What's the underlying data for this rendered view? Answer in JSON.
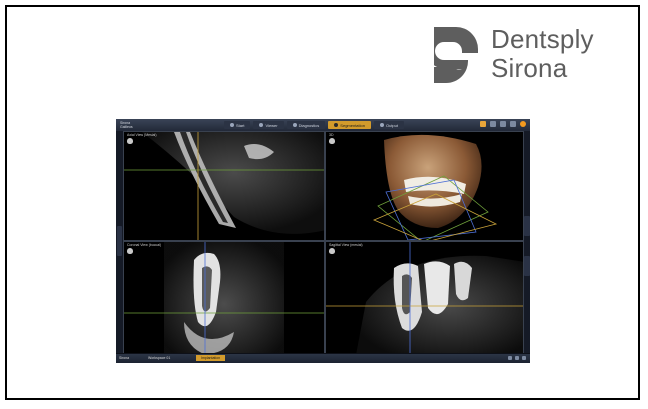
{
  "logo": {
    "line1": "Dentsply",
    "line2": "Sirona",
    "color": "#5e5e5e"
  },
  "app": {
    "brand_line1": "Sirona",
    "brand_line2": "Galileos",
    "tabs": [
      {
        "label": "Start",
        "icon": "start-icon"
      },
      {
        "label": "Viewer",
        "icon": "viewer-icon"
      },
      {
        "label": "Diagnostics",
        "icon": "diagnostics-icon"
      },
      {
        "label": "Segmentation",
        "icon": "segmentation-icon"
      },
      {
        "label": "Output",
        "icon": "output-icon"
      }
    ],
    "active_tab_index": 3,
    "accent_color": "#d29b2c",
    "viewports": {
      "panoramic": {
        "title": "Axial View (Mesial)"
      },
      "volume": {
        "title": "3D"
      },
      "coronal": {
        "title": "Coronal View (buccal)"
      },
      "sagittal": {
        "title": "Sagittal View (mesial)"
      }
    },
    "bottom": {
      "brand": "Sirona",
      "workspace": "Workspace 01",
      "active_tab": "Implantation"
    }
  }
}
